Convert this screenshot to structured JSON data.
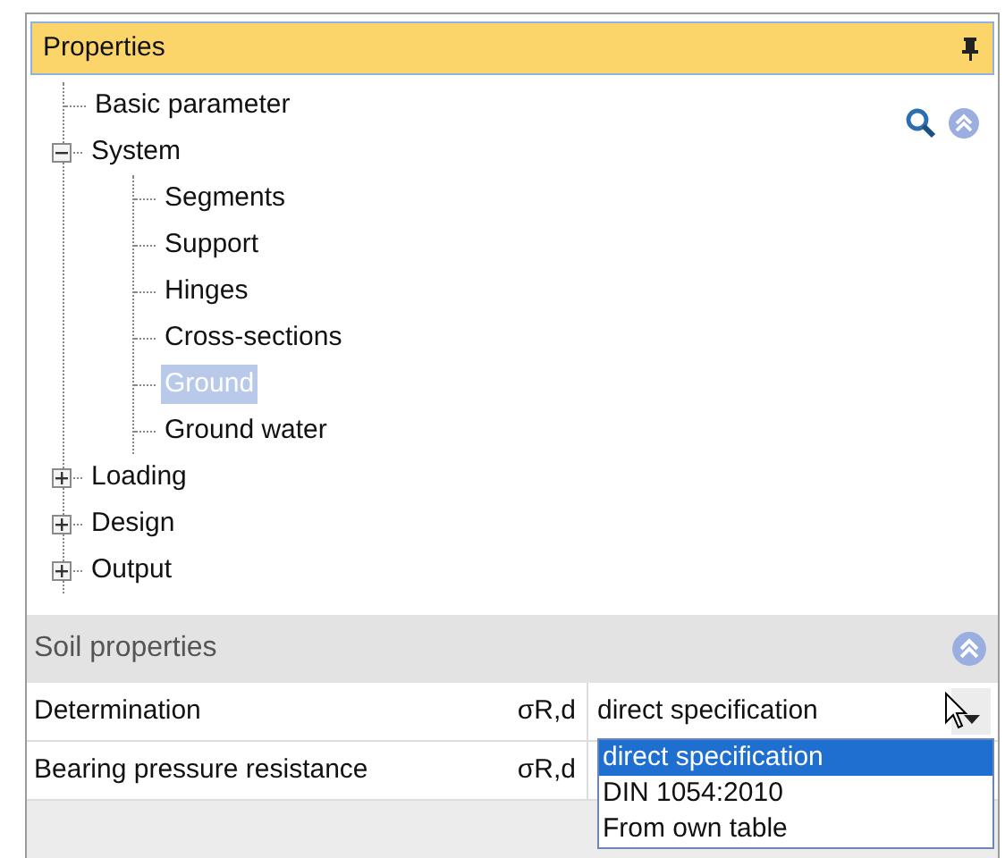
{
  "panel": {
    "title": "Properties"
  },
  "tree": [
    {
      "label": "Basic parameter",
      "selected": false
    },
    {
      "label": "System",
      "selected": false,
      "expanded": true,
      "children": [
        {
          "label": "Segments",
          "selected": false
        },
        {
          "label": "Support",
          "selected": false
        },
        {
          "label": "Hinges",
          "selected": false
        },
        {
          "label": "Cross-sections",
          "selected": false
        },
        {
          "label": "Ground",
          "selected": true
        },
        {
          "label": "Ground water",
          "selected": false
        }
      ]
    },
    {
      "label": "Loading",
      "selected": false,
      "expanded": false
    },
    {
      "label": "Design",
      "selected": false,
      "expanded": false
    },
    {
      "label": "Output",
      "selected": false,
      "expanded": false
    }
  ],
  "section": {
    "title": "Soil properties"
  },
  "properties": [
    {
      "name": "Determination",
      "symbol": "σR,d",
      "value": "direct specification",
      "open": true
    },
    {
      "name": "Bearing pressure resistance",
      "symbol": "σR,d"
    }
  ],
  "dropdown_options": [
    {
      "label": "direct specification",
      "selected": true
    },
    {
      "label": "DIN 1054:2010",
      "selected": false
    },
    {
      "label": "From own table",
      "selected": false
    }
  ]
}
